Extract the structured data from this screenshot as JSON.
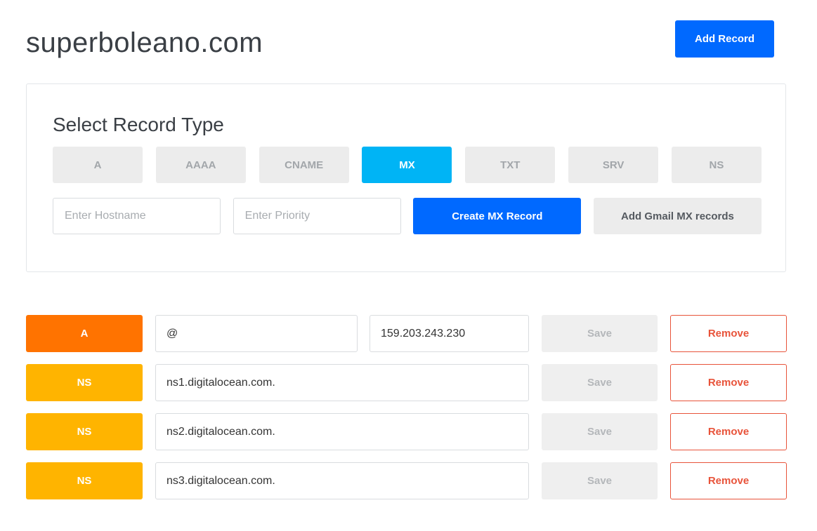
{
  "header": {
    "domain": "superboleano.com",
    "add_record_label": "Add Record"
  },
  "panel": {
    "heading": "Select Record Type",
    "types": [
      {
        "label": "A",
        "active": false
      },
      {
        "label": "AAAA",
        "active": false
      },
      {
        "label": "CNAME",
        "active": false
      },
      {
        "label": "MX",
        "active": true
      },
      {
        "label": "TXT",
        "active": false
      },
      {
        "label": "SRV",
        "active": false
      },
      {
        "label": "NS",
        "active": false
      }
    ],
    "hostname_placeholder": "Enter Hostname",
    "hostname_value": "",
    "priority_placeholder": "Enter Priority",
    "priority_value": "",
    "create_label": "Create MX Record",
    "gmail_label": "Add Gmail MX records"
  },
  "colors": {
    "primary": "#0069ff",
    "active_type": "#00b4f5",
    "type_A": "#ff7300",
    "type_NS": "#ffb400",
    "remove": "#e8533a"
  },
  "records": [
    {
      "type": "A",
      "name": "@",
      "value": "159.203.243.230",
      "save_label": "Save",
      "remove_label": "Remove"
    },
    {
      "type": "NS",
      "name": "ns1.digitalocean.com.",
      "save_label": "Save",
      "remove_label": "Remove"
    },
    {
      "type": "NS",
      "name": "ns2.digitalocean.com.",
      "save_label": "Save",
      "remove_label": "Remove"
    },
    {
      "type": "NS",
      "name": "ns3.digitalocean.com.",
      "save_label": "Save",
      "remove_label": "Remove"
    }
  ]
}
